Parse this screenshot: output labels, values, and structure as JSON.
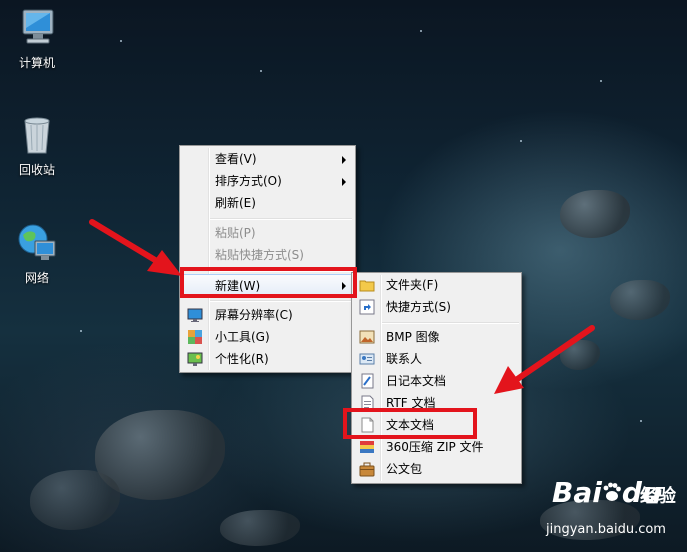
{
  "desktop": {
    "icons": [
      {
        "label": "计算机",
        "icon": "computer-icon"
      },
      {
        "label": "回收站",
        "icon": "recycle-bin-icon"
      },
      {
        "label": "网络",
        "icon": "network-icon"
      }
    ]
  },
  "context_menu": {
    "items": [
      {
        "label": "查看(V)",
        "submenu": true,
        "enabled": true
      },
      {
        "label": "排序方式(O)",
        "submenu": true,
        "enabled": true
      },
      {
        "label": "刷新(E)",
        "enabled": true
      },
      {
        "label": "粘贴(P)",
        "enabled": false
      },
      {
        "label": "粘贴快捷方式(S)",
        "enabled": false
      },
      {
        "label": "新建(W)",
        "submenu": true,
        "enabled": true,
        "highlighted": true
      },
      {
        "label": "屏幕分辨率(C)",
        "icon": "display-resolution-icon",
        "enabled": true
      },
      {
        "label": "小工具(G)",
        "icon": "gadgets-icon",
        "enabled": true
      },
      {
        "label": "个性化(R)",
        "icon": "personalize-icon",
        "enabled": true
      }
    ]
  },
  "new_submenu": {
    "items": [
      {
        "label": "文件夹(F)",
        "icon": "folder-icon"
      },
      {
        "label": "快捷方式(S)",
        "icon": "shortcut-icon"
      },
      {
        "label": "BMP 图像",
        "icon": "bmp-image-icon"
      },
      {
        "label": "联系人",
        "icon": "contact-icon"
      },
      {
        "label": "日记本文档",
        "icon": "journal-document-icon"
      },
      {
        "label": "RTF 文档",
        "icon": "rtf-document-icon"
      },
      {
        "label": "文本文档",
        "icon": "text-document-icon"
      },
      {
        "label": "360压缩 ZIP 文件",
        "icon": "zip-archive-icon"
      },
      {
        "label": "公文包",
        "icon": "briefcase-icon"
      }
    ]
  },
  "watermark": {
    "brand": "Bai",
    "brand2": "du",
    "product": "经验",
    "url": "jingyan.baidu.com"
  },
  "colors": {
    "annotation_red": "#e3141c",
    "menu_background": "#f0f0f0"
  }
}
